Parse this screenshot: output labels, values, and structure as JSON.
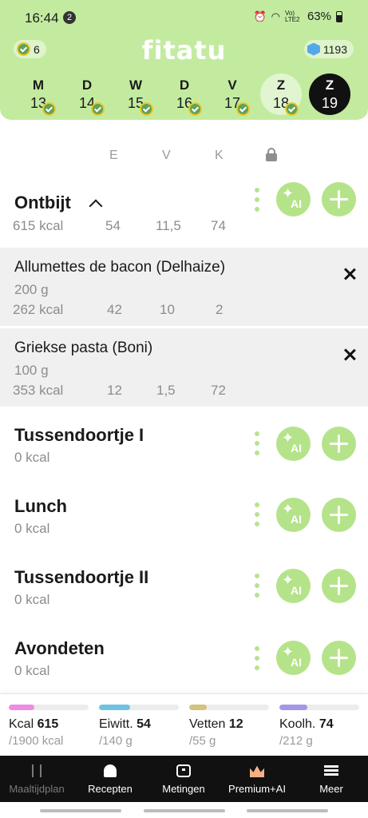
{
  "status_bar": {
    "time": "16:44",
    "notification_count": "2",
    "battery": "63%",
    "icons": [
      "alarm-icon",
      "wifi-icon",
      "signal-icon",
      "battery-icon"
    ],
    "network": "Vo) LTE2"
  },
  "header": {
    "logo": "fitatu",
    "streak_count": "6",
    "points": "1193",
    "colors": {
      "header_bg": "#c3eba0",
      "accent": "#b5e38a"
    }
  },
  "days": [
    {
      "letter": "M",
      "number": "13",
      "checked": true,
      "state": "normal"
    },
    {
      "letter": "D",
      "number": "14",
      "checked": true,
      "state": "normal"
    },
    {
      "letter": "W",
      "number": "15",
      "checked": true,
      "state": "normal"
    },
    {
      "letter": "D",
      "number": "16",
      "checked": true,
      "state": "normal"
    },
    {
      "letter": "V",
      "number": "17",
      "checked": true,
      "state": "normal"
    },
    {
      "letter": "Z",
      "number": "18",
      "checked": true,
      "state": "selected"
    },
    {
      "letter": "Z",
      "number": "19",
      "checked": false,
      "state": "today"
    }
  ],
  "columns": {
    "e": "E",
    "v": "V",
    "k": "K",
    "lock_icon": "lock-icon"
  },
  "meals": [
    {
      "title": "Ontbijt",
      "kcal": "615 kcal",
      "e": "54",
      "v": "11,5",
      "k": "74",
      "expanded": true,
      "items": [
        {
          "name": "Allumettes de bacon (Delhaize)",
          "qty": "200 g",
          "kcal": "262 kcal",
          "e": "42",
          "v": "10",
          "k": "2"
        },
        {
          "name": "Griekse pasta (Boni)",
          "qty": "100 g",
          "kcal": "353 kcal",
          "e": "12",
          "v": "1,5",
          "k": "72"
        }
      ]
    },
    {
      "title": "Tussendoortje I",
      "kcal": "0 kcal"
    },
    {
      "title": "Lunch",
      "kcal": "0 kcal"
    },
    {
      "title": "Tussendoortje II",
      "kcal": "0 kcal"
    },
    {
      "title": "Avondeten",
      "kcal": "0 kcal"
    }
  ],
  "ai_label": "AI",
  "summary": [
    {
      "label": "Kcal",
      "value": "615",
      "goal": "/1900 kcal",
      "progress": 0.32,
      "color": "#ef8be3"
    },
    {
      "label": "Eiwitt.",
      "value": "54",
      "goal": "/140 g",
      "progress": 0.39,
      "color": "#6ec3e3"
    },
    {
      "label": "Vetten",
      "value": "12",
      "goal": "/55 g",
      "progress": 0.22,
      "color": "#d4c27e"
    },
    {
      "label": "Koolh.",
      "value": "74",
      "goal": "/212 g",
      "progress": 0.35,
      "color": "#a596e8"
    }
  ],
  "nav": [
    {
      "label": "Maaltijdplan",
      "icon": "fork-knife-icon",
      "active": false
    },
    {
      "label": "Recepten",
      "icon": "chef-hat-icon",
      "active": true
    },
    {
      "label": "Metingen",
      "icon": "scale-icon",
      "active": true
    },
    {
      "label": "Premium+AI",
      "icon": "crown-icon",
      "active": true
    },
    {
      "label": "Meer",
      "icon": "menu-icon",
      "active": true
    }
  ]
}
